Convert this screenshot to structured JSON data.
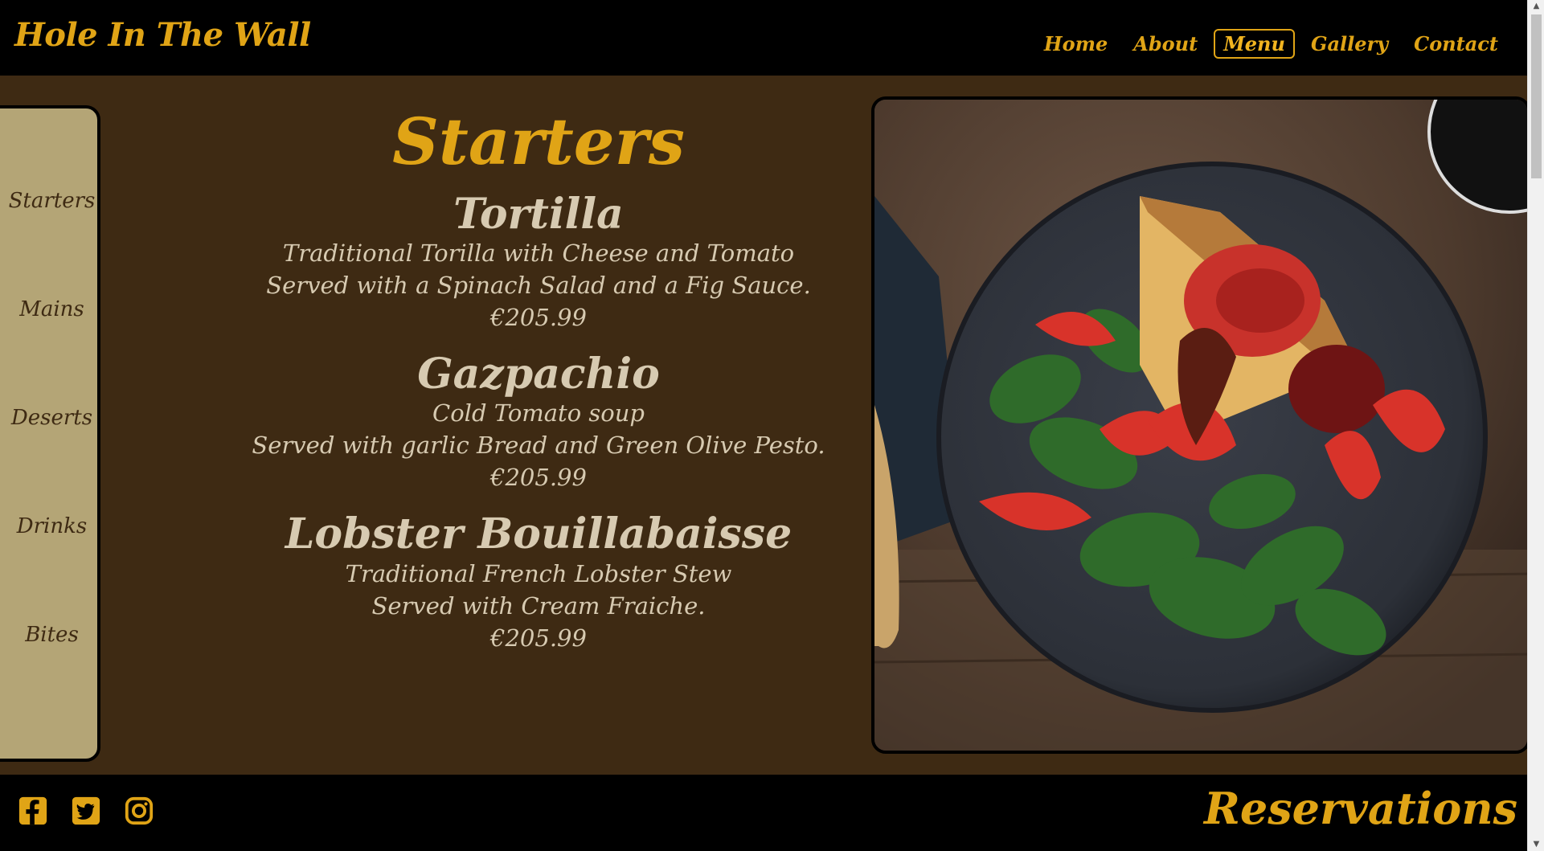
{
  "header": {
    "brand": "Hole In The Wall",
    "nav": [
      {
        "label": "Home",
        "active": false
      },
      {
        "label": "About",
        "active": false
      },
      {
        "label": "Menu",
        "active": true
      },
      {
        "label": "Gallery",
        "active": false
      },
      {
        "label": "Contact",
        "active": false
      }
    ]
  },
  "sidebar": {
    "items": [
      "Starters",
      "Mains",
      "Deserts",
      "Drinks",
      "Bites"
    ]
  },
  "menu": {
    "section_title": "Starters",
    "dishes": [
      {
        "name": "Tortilla",
        "lines": [
          "Traditional Torilla with Cheese and Tomato",
          "Served with a Spinach Salad and a Fig Sauce."
        ],
        "price": "€205.99"
      },
      {
        "name": "Gazpachio",
        "lines": [
          "Cold Tomato soup",
          "Served with garlic Bread and Green Olive Pesto."
        ],
        "price": "€205.99"
      },
      {
        "name": "Lobster Bouillabaisse",
        "lines": [
          "Traditional French Lobster Stew",
          "Served with Cream Fraiche."
        ],
        "price": "€205.99"
      }
    ]
  },
  "photo": {
    "icon": "food-photo"
  },
  "footer": {
    "social": [
      "facebook-icon",
      "twitter-icon",
      "instagram-icon"
    ],
    "reservations_label": "Reservations"
  },
  "colors": {
    "accent": "#e0a416",
    "background": "#3e2a13",
    "sidebar": "#b4a576",
    "text_light": "#d7cab1"
  }
}
